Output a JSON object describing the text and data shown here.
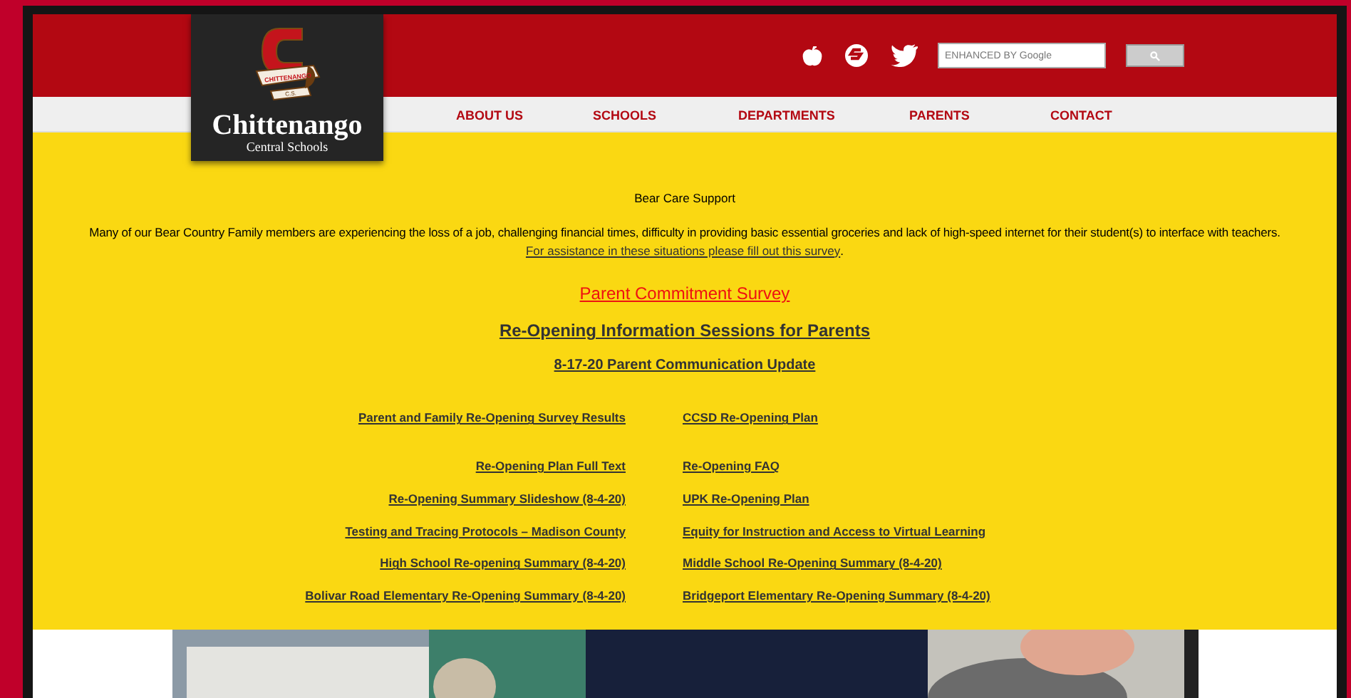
{
  "logo": {
    "ribbon_top": "CHITTENANGO",
    "ribbon_bottom": "C.S.",
    "name": "Chittenango",
    "subtitle": "Central Schools"
  },
  "search": {
    "placeholder": "ENHANCED BY Google"
  },
  "nav": [
    "ABOUT US",
    "SCHOOLS",
    "DEPARTMENTS",
    "PARENTS",
    "CONTACT"
  ],
  "notice": {
    "title": "Bear Care Support",
    "body": "Many of our Bear Country Family members are experiencing the loss of a job, challenging financial times, difficulty in providing basic essential groceries and lack of high-speed internet for their student(s) to interface with teachers.",
    "link": "For assistance in these situations please fill out this survey",
    "after_link": "."
  },
  "headline_links": [
    {
      "kind": "survey",
      "text": "Parent Commitment Survey"
    },
    {
      "kind": "large",
      "text": "Re-Opening Information Sessions for Parents"
    },
    {
      "kind": "medium",
      "text": "8-17-20 Parent Communication Update"
    }
  ],
  "link_rows": [
    {
      "left": "Parent and Family Re-Opening Survey Results",
      "right": "CCSD Re-Opening Plan"
    },
    {
      "left": "Re-Opening Plan Full Text",
      "right": "Re-Opening FAQ"
    },
    {
      "left": "Re-Opening Summary Slideshow (8-4-20)",
      "right": "UPK Re-Opening Plan"
    },
    {
      "left": "Testing and Tracing Protocols – Madison County",
      "right": "Equity for Instruction and Access to Virtual Learning"
    },
    {
      "left": "High School Re-opening Summary (8-4-20)",
      "right": "Middle School Re-Opening Summary (8-4-20)"
    },
    {
      "left": "Bolivar Road Elementary Re-Opening Summary (8-4-20)",
      "right": "Bridgeport Elementary Re-Opening Summary (8-4-20)"
    }
  ],
  "hero": {
    "kind": "picture"
  }
}
